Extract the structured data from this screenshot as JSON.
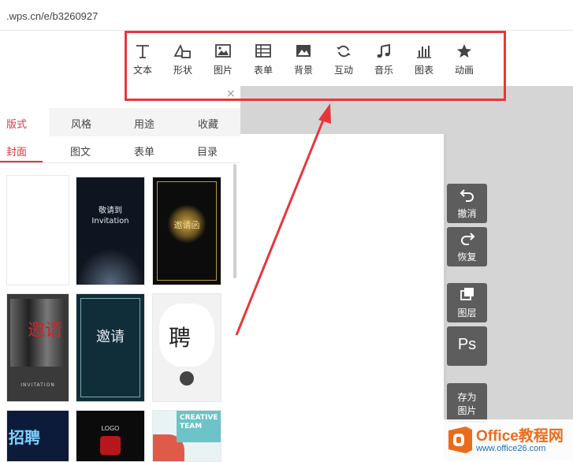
{
  "address_bar": {
    "url": ".wps.cn/e/b3260927"
  },
  "toolbar": {
    "items": [
      {
        "label": "文本",
        "icon": "text-icon"
      },
      {
        "label": "形状",
        "icon": "shape-icon"
      },
      {
        "label": "图片",
        "icon": "image-icon"
      },
      {
        "label": "表单",
        "icon": "form-icon"
      },
      {
        "label": "背景",
        "icon": "background-icon"
      },
      {
        "label": "互动",
        "icon": "interact-icon"
      },
      {
        "label": "音乐",
        "icon": "music-icon"
      },
      {
        "label": "图表",
        "icon": "chart-icon"
      },
      {
        "label": "动画",
        "icon": "star-icon"
      }
    ],
    "close_symbol": "×"
  },
  "left_panel": {
    "tabs": [
      "版式",
      "风格",
      "用途",
      "收藏"
    ],
    "subtabs": [
      "封面",
      "图文",
      "表单",
      "目录"
    ],
    "active_tab": "版式",
    "active_subtab": "封面",
    "thumbnails": [
      {
        "text": ""
      },
      {
        "text": "敬请到 Invitation"
      },
      {
        "text": "邀请函"
      },
      {
        "text": "INVITATION"
      },
      {
        "text": "邀请"
      },
      {
        "text": "聘"
      },
      {
        "text": "招聘"
      },
      {
        "text": "LOGO"
      },
      {
        "text": "CREATIVE TEAM"
      }
    ]
  },
  "side_tools": [
    {
      "label": "撤消",
      "icon": "undo-icon"
    },
    {
      "label": "恢复",
      "icon": "redo-icon"
    },
    {
      "label": "图层",
      "icon": "layers-icon"
    },
    {
      "label": "Ps",
      "icon": "ps-icon"
    },
    {
      "label": "存为\n图片",
      "line1": "存为",
      "line2": "图片"
    }
  ],
  "watermark": {
    "title": "Office教程网",
    "url": "www.office26.com"
  },
  "colors": {
    "accent": "#e0383a",
    "highlight_box": "#e8373b",
    "arrow": "#e8373b",
    "side_button": "#5d5d5d"
  }
}
